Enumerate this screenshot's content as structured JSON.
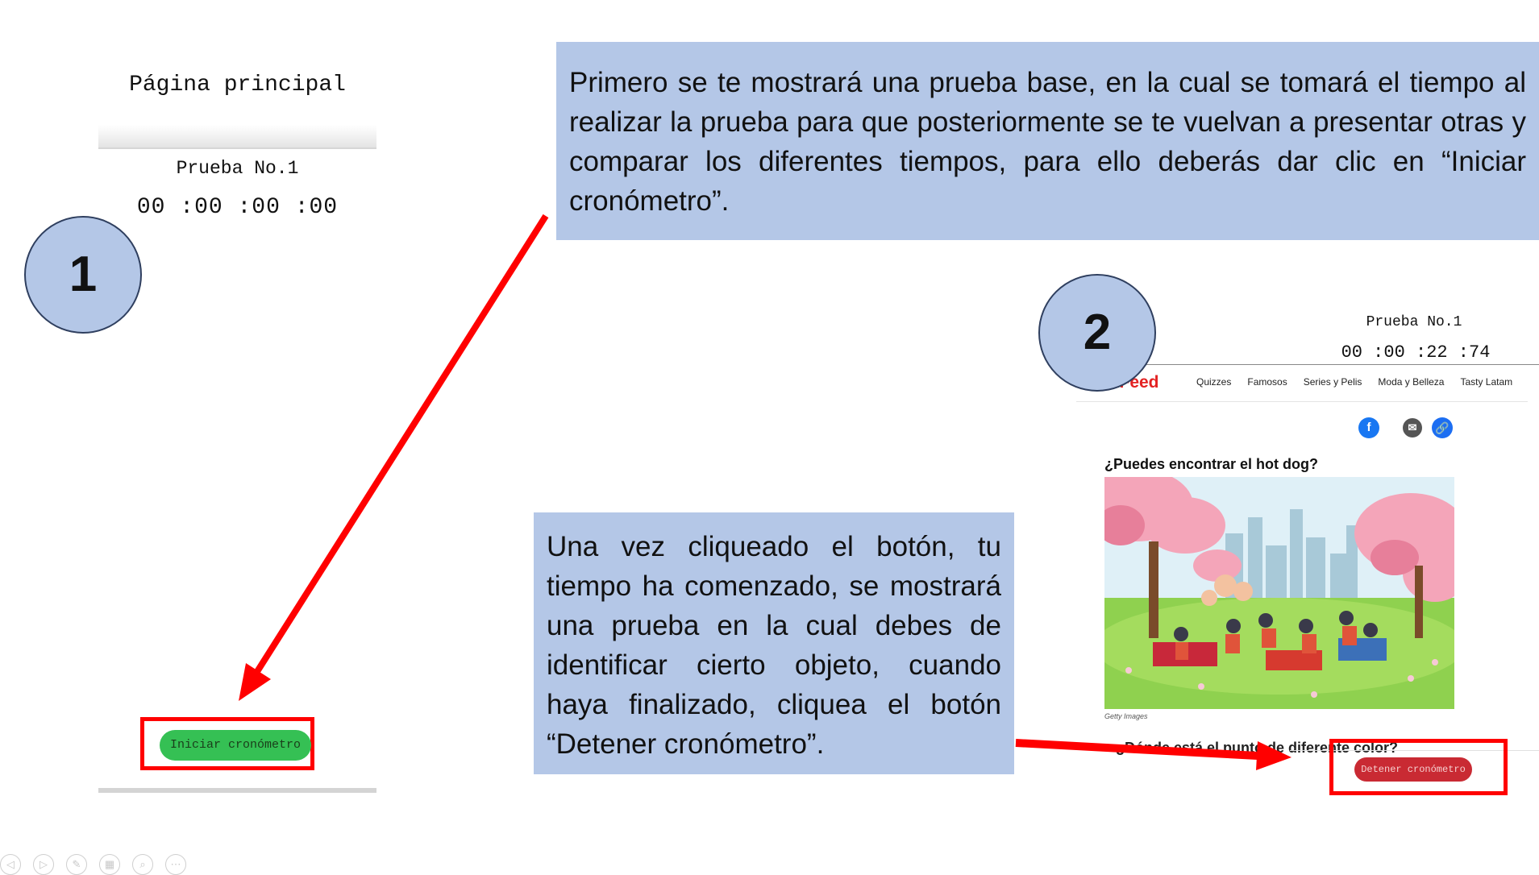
{
  "screen1": {
    "title": "Página principal",
    "test_label": "Prueba No.1",
    "timer": "00 :00 :00 :00",
    "start_button": "Iniciar cronómetro"
  },
  "markers": {
    "one": "1",
    "two": "2"
  },
  "instructions": {
    "top": "Primero se te mostrará una prueba base, en la cual se tomará el tiempo al realizar la prueba para que posteriormente se te vuelvan a presentar otras y comparar los diferentes tiempos, para ello deberás dar clic en “Iniciar cronómetro”.",
    "bottom": "Una vez cliqueado el botón, tu tiempo ha comenzado, se mostrará una prueba en la cual debes de identificar cierto objeto, cuando haya finalizado, cliquea el botón “Detener cronómetro”."
  },
  "screen2": {
    "test_label": "Prueba No.1",
    "timer": "00 :00 :22 :74",
    "brand": "zFeed",
    "nav": [
      "Quizzes",
      "Famosos",
      "Series y Pelis",
      "Moda y Belleza",
      "Tasty Latam"
    ],
    "question": "¿Puedes encontrar el hot dog?",
    "image_credit": "Getty Images",
    "next_question": "¿Dónde está el punto de diferente color?",
    "stop_button": "Detener cronómetro",
    "share_icons": [
      "facebook-icon",
      "mail-icon",
      "link-icon"
    ]
  },
  "colors": {
    "note_background": "#b4c7e7",
    "arrow": "#ff0000",
    "start_button": "#35c054",
    "stop_button": "#c92a33",
    "brand": "#e32222"
  },
  "toolbar": [
    "previous-icon",
    "next-icon",
    "pen-icon",
    "slides-icon",
    "zoom-icon",
    "more-icon"
  ]
}
